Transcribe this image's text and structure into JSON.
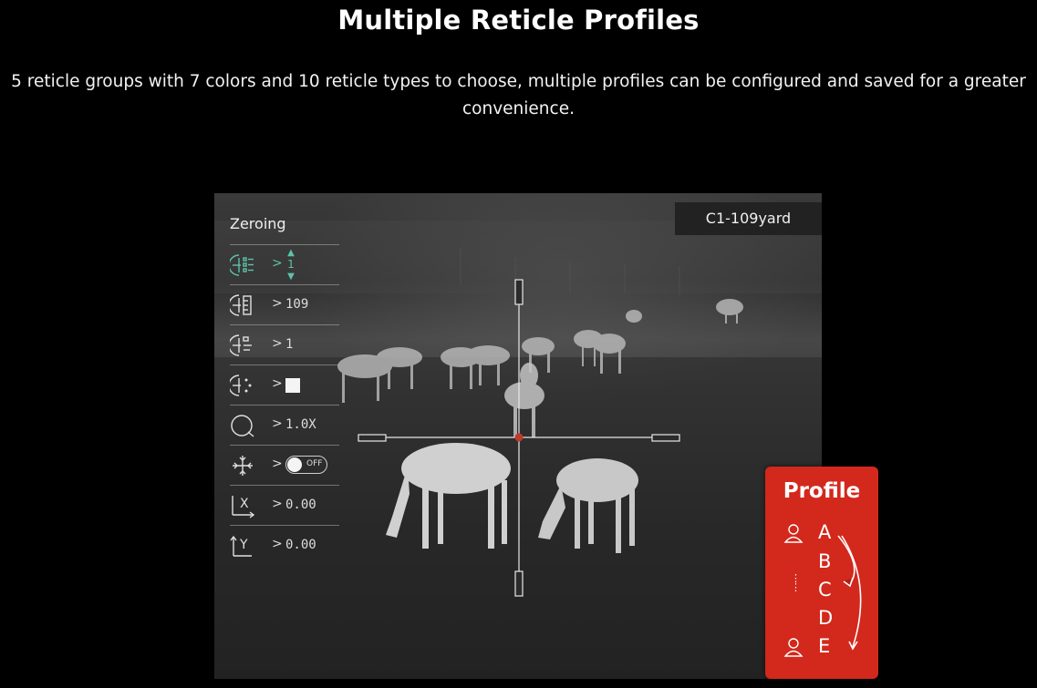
{
  "header": {
    "title": "Multiple Reticle Profiles",
    "description": "5 reticle groups with 7 colors and 10 reticle types to choose, multiple profiles can be configured and saved for a greater convenience."
  },
  "viewer": {
    "profile_badge": "C1-109yard",
    "menu": {
      "title": "Zeroing",
      "rows": [
        {
          "icon": "reticle-group-icon",
          "arrow": ">",
          "value": "1",
          "active": true
        },
        {
          "icon": "zeroing-distance-icon",
          "arrow": ">",
          "value": "109"
        },
        {
          "icon": "reticle-type-icon",
          "arrow": ">",
          "value": "1"
        },
        {
          "icon": "reticle-color-icon",
          "arrow": ">",
          "value": "color-white"
        },
        {
          "icon": "zoom-icon",
          "arrow": ">",
          "value": "1.0X"
        },
        {
          "icon": "freeze-icon",
          "arrow": ">",
          "value": "OFF"
        },
        {
          "icon": "x-offset-icon",
          "arrow": ">",
          "value": "0.00"
        },
        {
          "icon": "y-offset-icon",
          "arrow": ">",
          "value": "0.00"
        }
      ]
    }
  },
  "profile_panel": {
    "title": "Profile",
    "letters": [
      "A",
      "B",
      "C",
      "D",
      "E"
    ],
    "dots": "⋮⋮",
    "accent_color": "#d3281c"
  },
  "colors": {
    "active_menu": "#5ec2a8",
    "reticle_center": "#c0392b"
  }
}
